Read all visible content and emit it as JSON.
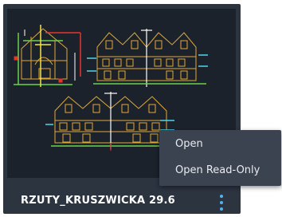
{
  "file": {
    "title": "RZUTY_KRUSZWICKA 29.6"
  },
  "actions": {
    "more_icon": "vertical-ellipsis-icon"
  },
  "menu": {
    "items": [
      {
        "label": "Open"
      },
      {
        "label": "Open Read-Only"
      }
    ]
  },
  "colors": {
    "card_bg": "#2c3440",
    "thumbnail_bg": "#1c222b",
    "drawing_lines": "#e0a83a",
    "accent": "#4fb3ef",
    "menu_bg": "#3b4250"
  }
}
